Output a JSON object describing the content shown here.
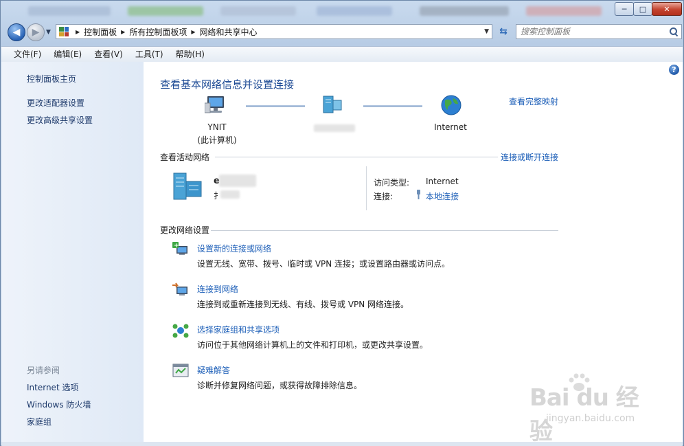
{
  "window": {
    "controls": {
      "minimize": "─",
      "maximize": "□",
      "close": "✕"
    }
  },
  "nav": {
    "back_glyph": "◀",
    "forward_glyph": "▶",
    "breadcrumb": [
      "控制面板",
      "所有控制面板项",
      "网络和共享中心"
    ],
    "crumb_sep": "▶",
    "dropdown_glyph": "▼",
    "refresh_glyph": "⇆",
    "search_placeholder": "搜索控制面板"
  },
  "menu": [
    "文件(F)",
    "编辑(E)",
    "查看(V)",
    "工具(T)",
    "帮助(H)"
  ],
  "sidebar": {
    "home": "控制面板主页",
    "links": [
      "更改适配器设置",
      "更改高级共享设置"
    ],
    "see_also_heading": "另请参阅",
    "see_also": [
      "Internet 选项",
      "Windows 防火墙",
      "家庭组"
    ]
  },
  "main": {
    "help_glyph": "?",
    "title": "查看基本网络信息并设置连接",
    "full_map_link": "查看完整映射",
    "nodes": {
      "computer_name": "YNIT",
      "computer_sub": "(此计算机)",
      "internet": "Internet"
    },
    "active_section": {
      "label": "查看活动网络",
      "link": "连接或断开连接",
      "net_name_partial": "e",
      "net_type_partial": "扌",
      "access_type_key": "访问类型:",
      "access_type_val": "Internet",
      "connection_key": "连接:",
      "connection_val": "本地连接"
    },
    "change_section": {
      "label": "更改网络设置",
      "tasks": [
        {
          "title": "设置新的连接或网络",
          "desc": "设置无线、宽带、拨号、临时或 VPN 连接；或设置路由器或访问点。"
        },
        {
          "title": "连接到网络",
          "desc": "连接到或重新连接到无线、有线、拨号或 VPN 网络连接。"
        },
        {
          "title": "选择家庭组和共享选项",
          "desc": "访问位于其他网络计算机上的文件和打印机，或更改共享设置。"
        },
        {
          "title": "疑难解答",
          "desc": "诊断并修复网络问题，或获得故障排除信息。"
        }
      ]
    }
  },
  "watermark": {
    "brand": "Bai du 经验",
    "sub": "jingyan.baidu.com"
  },
  "colors": {
    "link": "#1d5fb8",
    "title": "#1d4a94",
    "sidebar_bg": "#e4ecf7"
  }
}
